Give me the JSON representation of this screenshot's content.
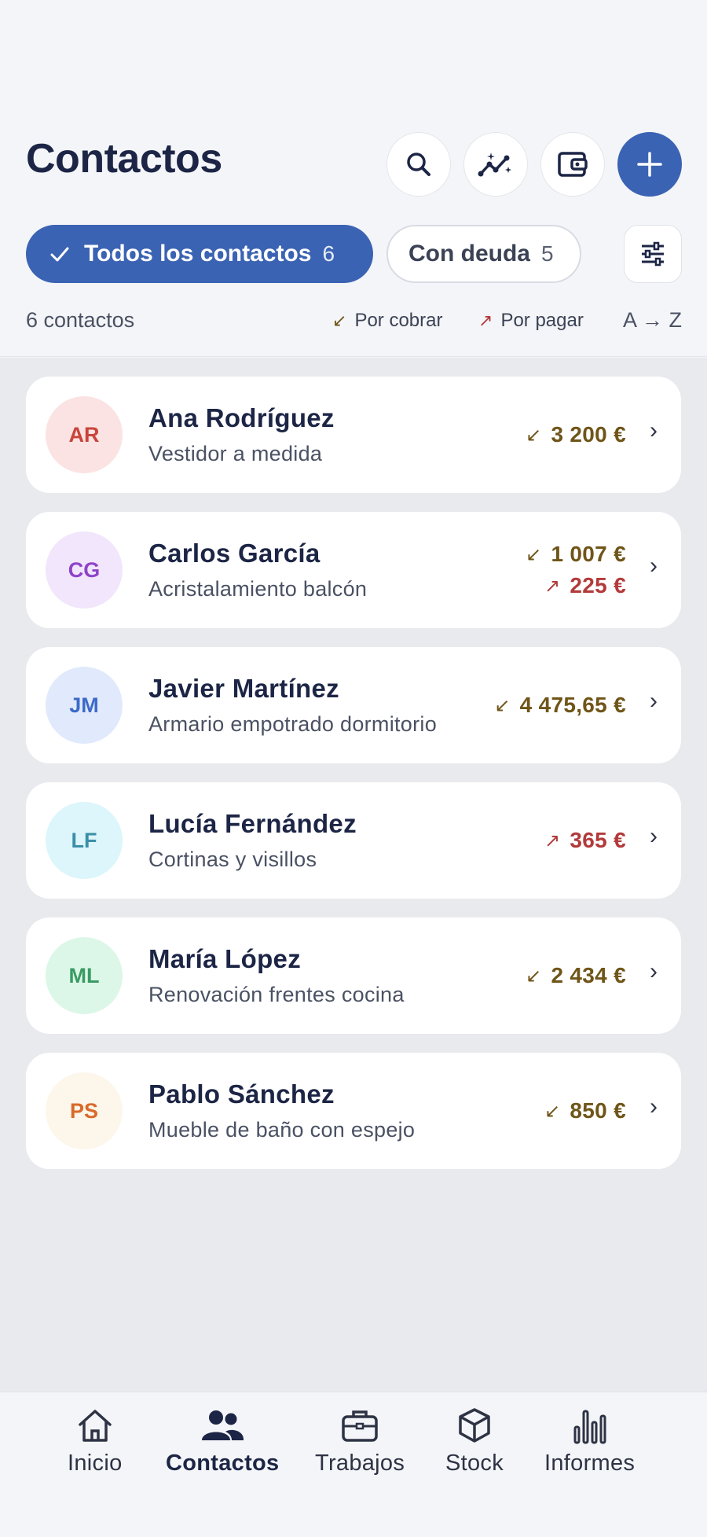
{
  "header": {
    "title": "Contactos"
  },
  "chips": {
    "all": {
      "label": "Todos los contactos",
      "count": "6"
    },
    "debt": {
      "label": "Con deuda",
      "count": "5"
    }
  },
  "summary": {
    "count_text": "6 contactos",
    "receivable_label": "Por cobrar",
    "payable_label": "Por pagar",
    "sort_label": "A → Z"
  },
  "contacts": [
    {
      "initials": "AR",
      "name": "Ana Rodríguez",
      "subtitle": "Vestidor a medida",
      "receivable": "3 200 €",
      "payable": ""
    },
    {
      "initials": "CG",
      "name": "Carlos García",
      "subtitle": "Acristalamiento balcón",
      "receivable": "1 007 €",
      "payable": "225 €"
    },
    {
      "initials": "JM",
      "name": "Javier Martínez",
      "subtitle": "Armario empotrado dormitorio",
      "receivable": "4 475,65 €",
      "payable": ""
    },
    {
      "initials": "LF",
      "name": "Lucía Fernández",
      "subtitle": "Cortinas y visillos",
      "receivable": "",
      "payable": "365 €"
    },
    {
      "initials": "ML",
      "name": "María López",
      "subtitle": "Renovación frentes cocina",
      "receivable": "2 434 €",
      "payable": ""
    },
    {
      "initials": "PS",
      "name": "Pablo Sánchez",
      "subtitle": "Mueble de baño con espejo",
      "receivable": "850 €",
      "payable": ""
    }
  ],
  "nav": {
    "home": "Inicio",
    "contacts": "Contactos",
    "jobs": "Trabajos",
    "stock": "Stock",
    "reports": "Informes"
  },
  "colors": {
    "primary": "#3b63b3",
    "receivable": "#6f5518",
    "payable": "#b33a3a"
  }
}
